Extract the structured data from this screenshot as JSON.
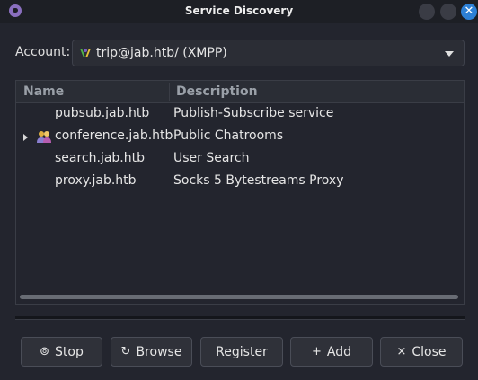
{
  "window": {
    "title": "Service Discovery",
    "close_glyph": "✕"
  },
  "account": {
    "label": "Account:",
    "value": "trip@jab.htb/ (XMPP)",
    "icon": "jabber-icon"
  },
  "table": {
    "columns": [
      "Name",
      "Description"
    ],
    "rows": [
      {
        "name": "pubsub.jab.htb",
        "description": "Publish-Subscribe service",
        "expandable": false,
        "icon": ""
      },
      {
        "name": "conference.jab.htb",
        "description": "Public Chatrooms",
        "expandable": true,
        "icon": "people-icon"
      },
      {
        "name": "search.jab.htb",
        "description": "User Search",
        "expandable": false,
        "icon": ""
      },
      {
        "name": "proxy.jab.htb",
        "description": "Socks 5 Bytestreams Proxy",
        "expandable": false,
        "icon": ""
      }
    ]
  },
  "buttons": {
    "stop": {
      "label": "Stop",
      "glyph": "⊚"
    },
    "browse": {
      "label": "Browse",
      "glyph": "↻"
    },
    "register": {
      "label": "Register"
    },
    "add": {
      "label": "Add",
      "glyph": "+"
    },
    "close": {
      "label": "Close",
      "glyph": "×"
    }
  },
  "colors": {
    "background": "#23252e",
    "accent": "#2d80d6"
  }
}
